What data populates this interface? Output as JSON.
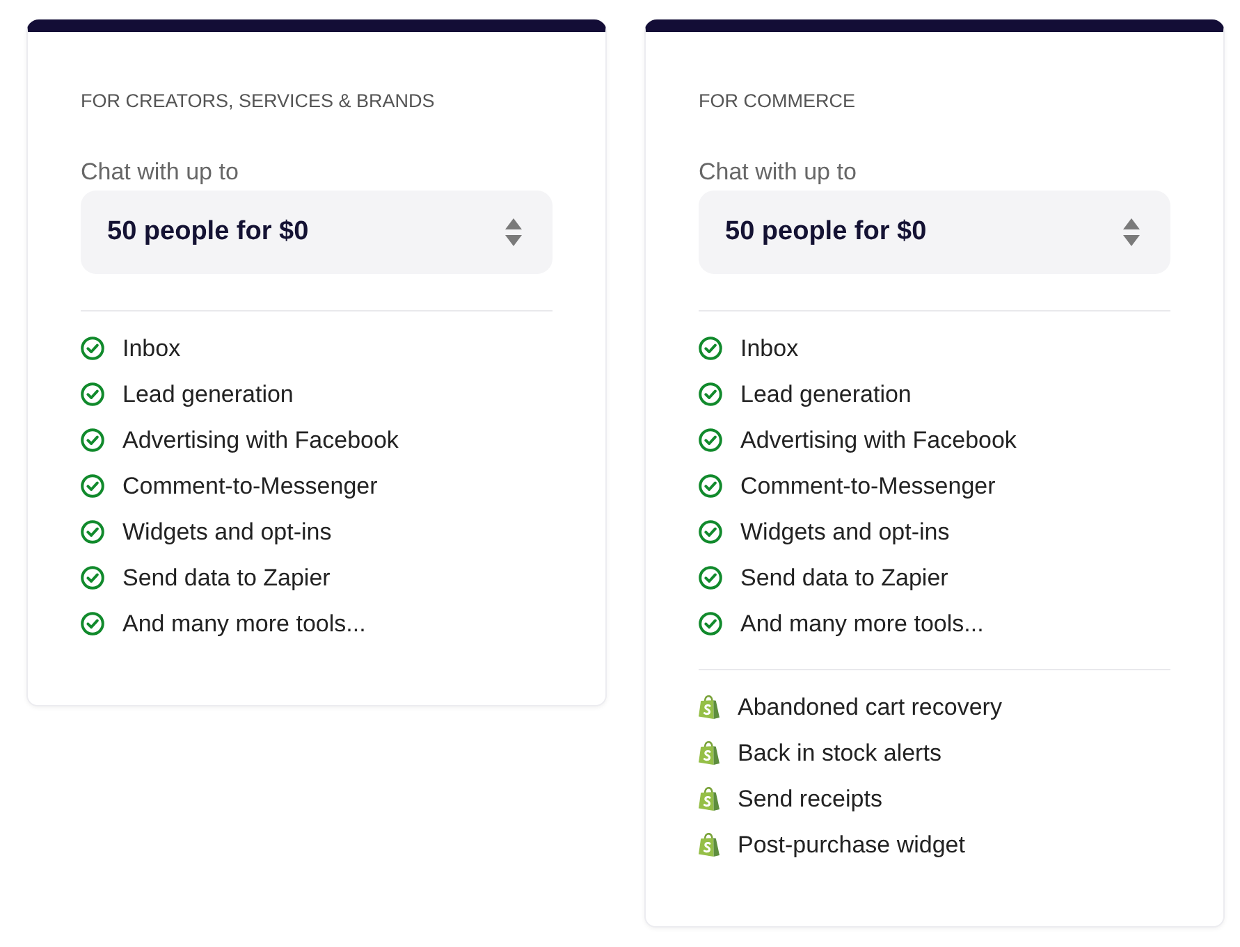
{
  "plans": [
    {
      "category": "FOR CREATORS, SERVICES & BRANDS",
      "prompt": "Chat with up to",
      "select": {
        "value": "50 people for $0"
      },
      "feature_groups": [
        [
          {
            "kind": "check",
            "text": "Inbox"
          },
          {
            "kind": "check",
            "text": "Lead generation"
          },
          {
            "kind": "check",
            "text": "Advertising with Facebook"
          },
          {
            "kind": "check",
            "text": "Comment-to-Messenger"
          },
          {
            "kind": "check",
            "text": "Widgets and opt-ins"
          },
          {
            "kind": "check",
            "text": "Send data to Zapier"
          },
          {
            "kind": "check",
            "text": "And many more tools..."
          }
        ]
      ]
    },
    {
      "category": "FOR COMMERCE",
      "prompt": "Chat with up to",
      "select": {
        "value": "50 people for $0"
      },
      "feature_groups": [
        [
          {
            "kind": "check",
            "text": "Inbox"
          },
          {
            "kind": "check",
            "text": "Lead generation"
          },
          {
            "kind": "check",
            "text": "Advertising with Facebook"
          },
          {
            "kind": "check",
            "text": "Comment-to-Messenger"
          },
          {
            "kind": "check",
            "text": "Widgets and opt-ins"
          },
          {
            "kind": "check",
            "text": "Send data to Zapier"
          },
          {
            "kind": "check",
            "text": "And many more tools..."
          }
        ],
        [
          {
            "kind": "shop",
            "text": "Abandoned cart recovery"
          },
          {
            "kind": "shop",
            "text": "Back in stock alerts"
          },
          {
            "kind": "shop",
            "text": "Send receipts"
          },
          {
            "kind": "shop",
            "text": "Post-purchase widget"
          }
        ]
      ]
    }
  ]
}
